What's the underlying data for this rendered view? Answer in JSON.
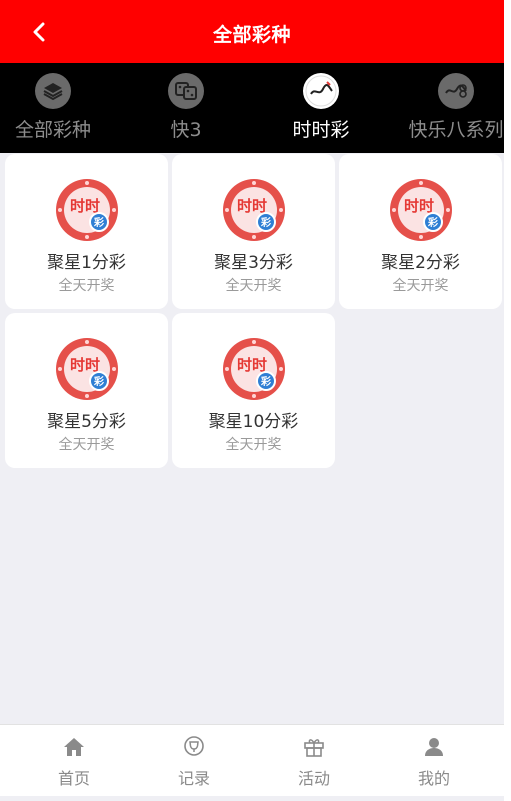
{
  "header": {
    "title": "全部彩种",
    "back_icon": "chevron-left-icon"
  },
  "tabs": [
    {
      "label": "全部彩种",
      "icon": "layers-icon",
      "active": false
    },
    {
      "label": "快3",
      "icon": "dice-icon",
      "active": false
    },
    {
      "label": "时时彩",
      "icon": "ssc-logo-icon",
      "active": true
    },
    {
      "label": "快乐八系列",
      "icon": "kl8-logo-icon",
      "active": false
    }
  ],
  "games": [
    {
      "name": "聚星1分彩",
      "subtitle": "全天开奖"
    },
    {
      "name": "聚星3分彩",
      "subtitle": "全天开奖"
    },
    {
      "name": "聚星2分彩",
      "subtitle": "全天开奖"
    },
    {
      "name": "聚星5分彩",
      "subtitle": "全天开奖"
    },
    {
      "name": "聚星10分彩",
      "subtitle": "全天开奖"
    }
  ],
  "game_icon": {
    "text_top": "时时",
    "text_badge": "彩"
  },
  "bottom_nav": [
    {
      "label": "首页",
      "icon": "home-icon"
    },
    {
      "label": "记录",
      "icon": "trophy-icon"
    },
    {
      "label": "活动",
      "icon": "gift-icon"
    },
    {
      "label": "我的",
      "icon": "user-icon"
    }
  ],
  "colors": {
    "header_bg": "#ff0000",
    "tabs_bg": "#000000",
    "page_bg": "#efeff4"
  }
}
